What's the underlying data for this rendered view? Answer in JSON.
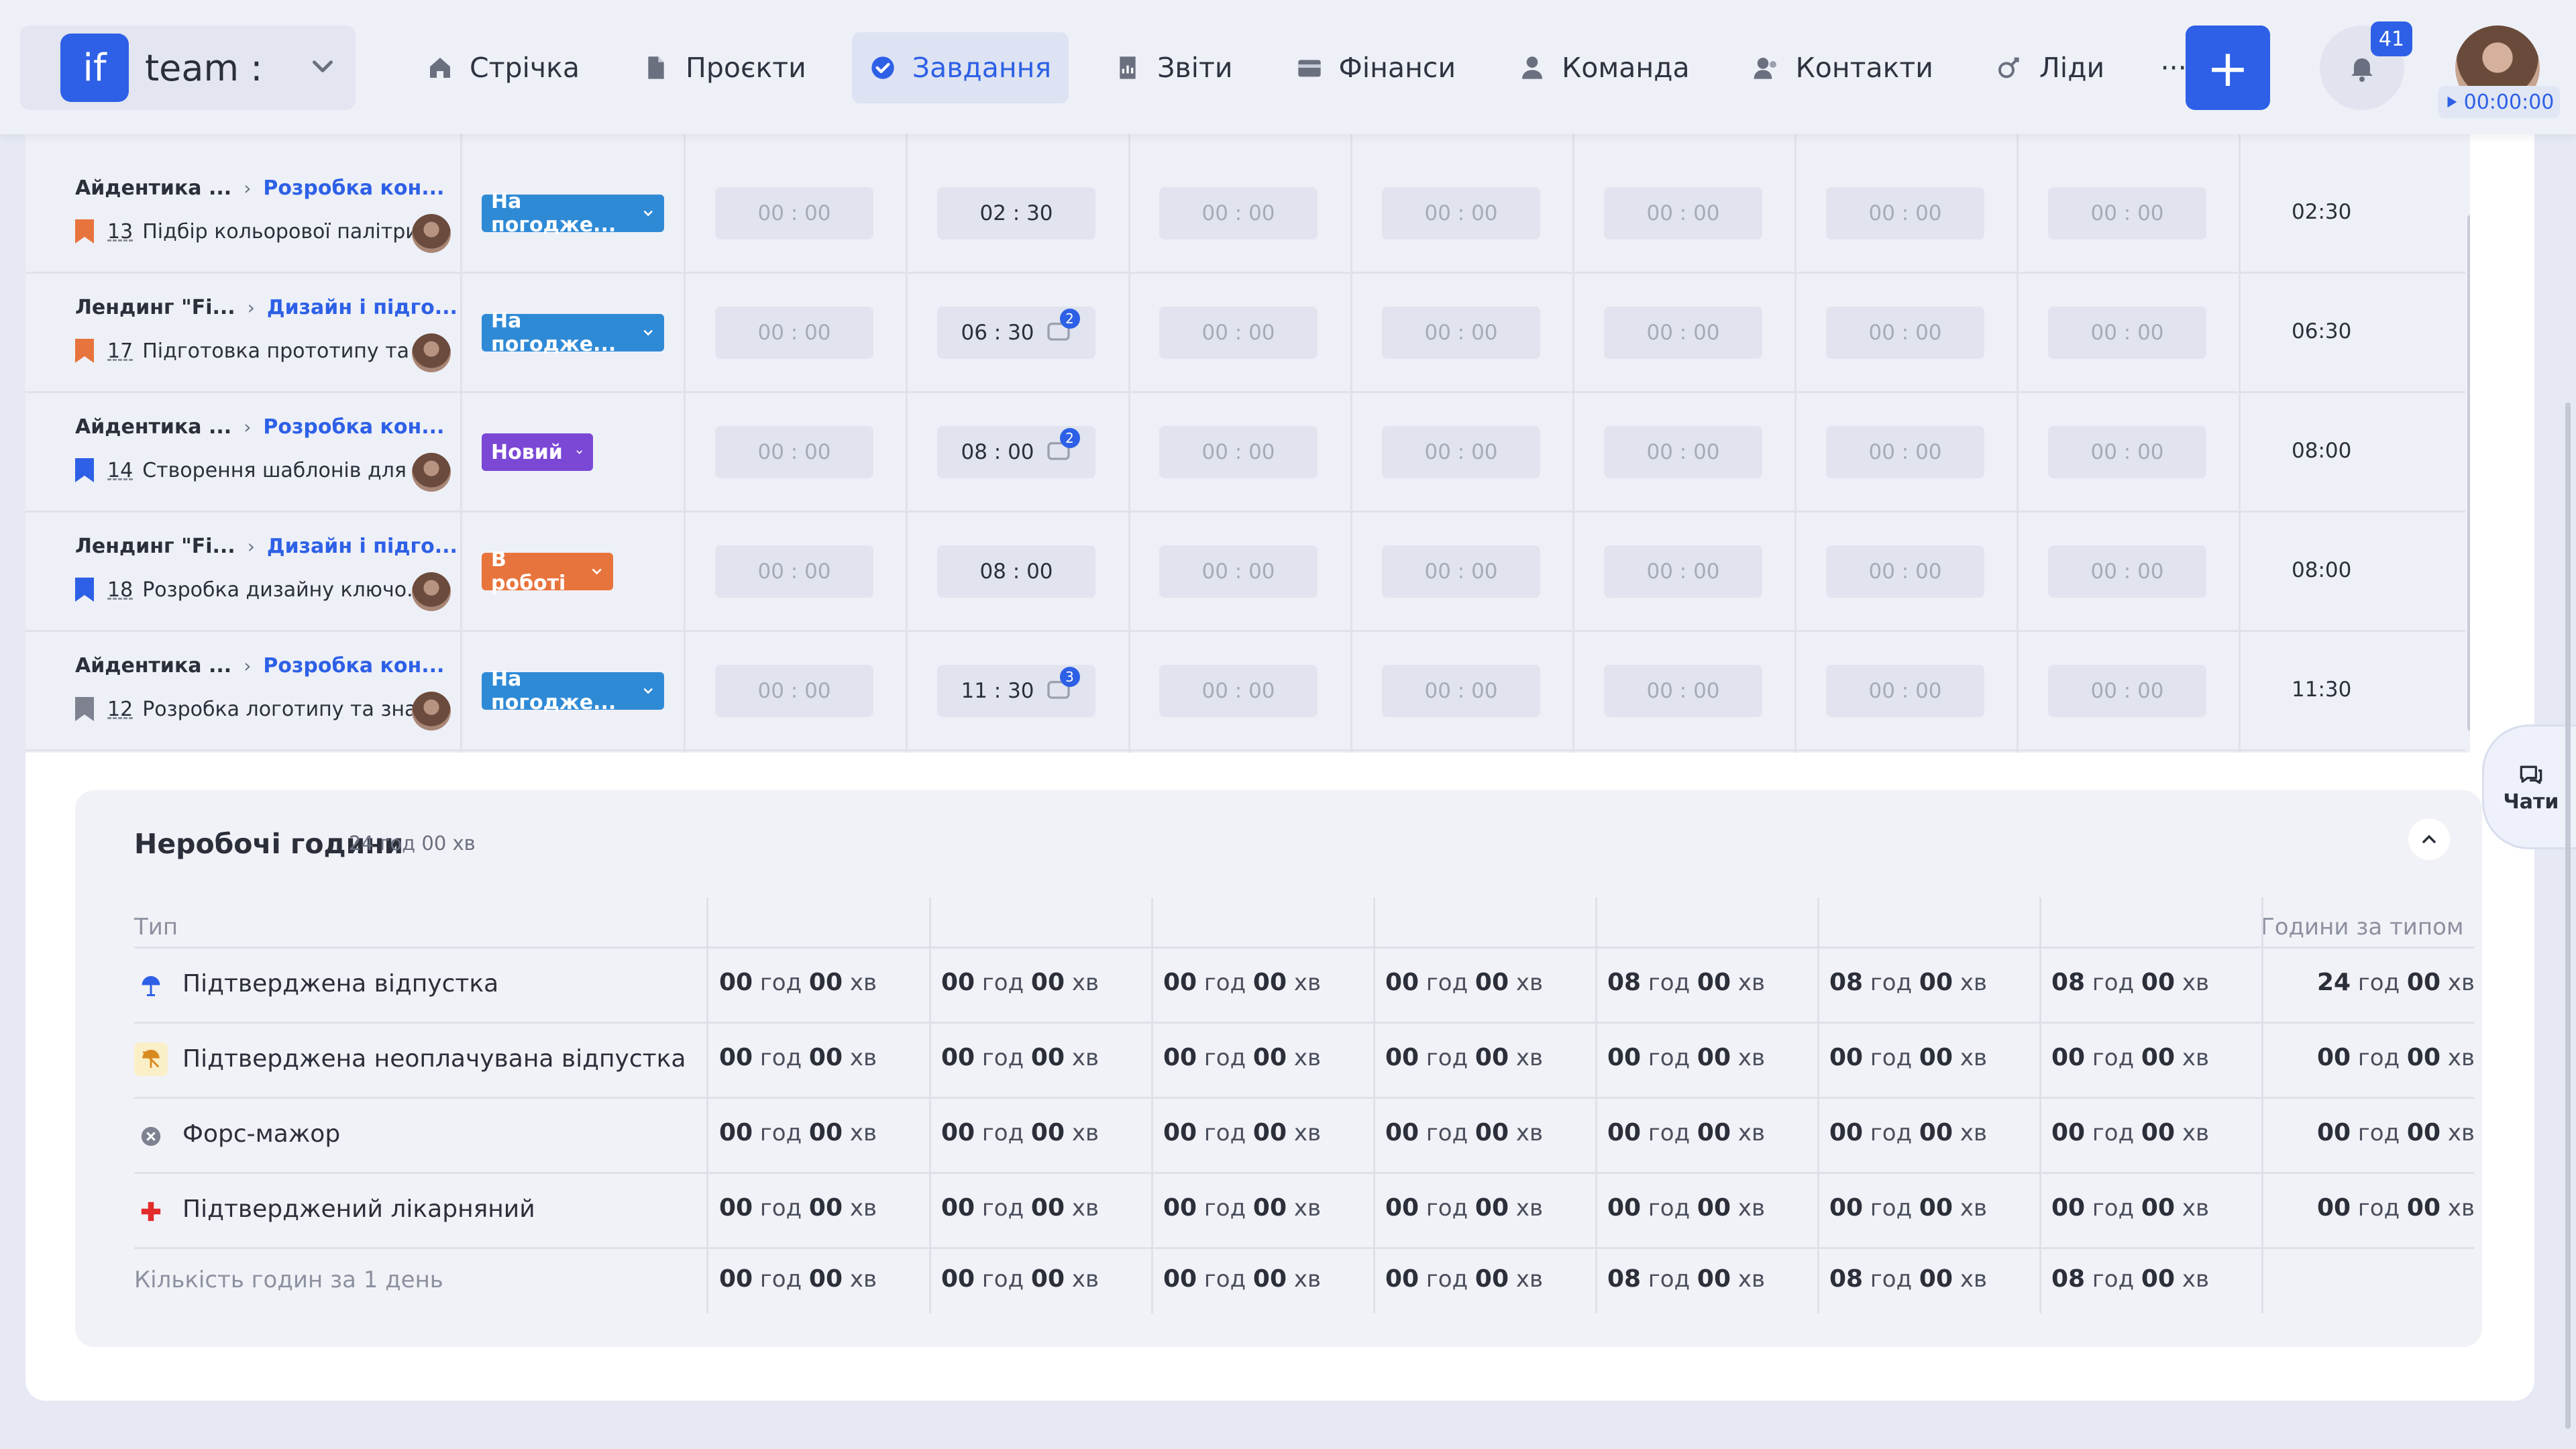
{
  "app": {
    "logo_text": "if",
    "team_name": "team :",
    "notifications_count": "41",
    "timer": "00:00:00",
    "add_label": "+"
  },
  "nav": [
    {
      "label": "Стрічка",
      "icon": "home-icon",
      "active": false
    },
    {
      "label": "Проєкти",
      "icon": "document-icon",
      "active": false
    },
    {
      "label": "Завдання",
      "icon": "check-circle-icon",
      "active": true
    },
    {
      "label": "Звіти",
      "icon": "report-icon",
      "active": false
    },
    {
      "label": "Фінанси",
      "icon": "wallet-icon",
      "active": false
    },
    {
      "label": "Команда",
      "icon": "person-icon",
      "active": false
    },
    {
      "label": "Контакти",
      "icon": "contacts-icon",
      "active": false
    },
    {
      "label": "Ліди",
      "icon": "leads-icon",
      "active": false
    }
  ],
  "nav_more": "···",
  "tasks": [
    {
      "project": "Айдентика ...",
      "subproject": "Розробка кон...",
      "num": "13",
      "title": "Підбір кольорової палітри...",
      "flag_color": "#e8743d",
      "status": "На погодже...",
      "status_color": "#2f8ad6",
      "cells": [
        "00 : 00",
        "02 : 30",
        "00 : 00",
        "00 : 00",
        "00 : 00",
        "00 : 00",
        "00 : 00"
      ],
      "comments": null,
      "total": "02:30"
    },
    {
      "project": "Лендинг \"Fi...",
      "subproject": "Дизайн і підго...",
      "num": "17",
      "title": "Підготовка прототипу та ...",
      "flag_color": "#e8743d",
      "status": "На погодже...",
      "status_color": "#2f8ad6",
      "cells": [
        "00 : 00",
        "06 : 30",
        "00 : 00",
        "00 : 00",
        "00 : 00",
        "00 : 00",
        "00 : 00"
      ],
      "comments": "2",
      "total": "06:30"
    },
    {
      "project": "Айдентика ...",
      "subproject": "Розробка кон...",
      "num": "14",
      "title": "Створення шаблонів для ...",
      "flag_color": "#2d60e6",
      "status": "Новий",
      "status_color": "#7b48d6",
      "cells": [
        "00 : 00",
        "08 : 00",
        "00 : 00",
        "00 : 00",
        "00 : 00",
        "00 : 00",
        "00 : 00"
      ],
      "comments": "2",
      "total": "08:00"
    },
    {
      "project": "Лендинг \"Fi...",
      "subproject": "Дизайн і підго...",
      "num": "18",
      "title": "Розробка дизайну ключо...",
      "flag_color": "#2d60e6",
      "status": "В роботі",
      "status_color": "#e8743d",
      "cells": [
        "00 : 00",
        "08 : 00",
        "00 : 00",
        "00 : 00",
        "00 : 00",
        "00 : 00",
        "00 : 00"
      ],
      "comments": null,
      "total": "08:00"
    },
    {
      "project": "Айдентика ...",
      "subproject": "Розробка кон...",
      "num": "12",
      "title": "Розробка логотипу та зна...",
      "flag_color": "#7d8190",
      "status": "На погодже...",
      "status_color": "#2f8ad6",
      "cells": [
        "00 : 00",
        "11 : 30",
        "00 : 00",
        "00 : 00",
        "00 : 00",
        "00 : 00",
        "00 : 00"
      ],
      "comments": "3",
      "total": "11:30"
    }
  ],
  "nonwork": {
    "title": "Неробочі години",
    "total": "24 год 00 хв",
    "type_header": "Тип",
    "by_type_header": "Години за типом",
    "hours_unit": "год",
    "min_unit": "хв",
    "rows": [
      {
        "label": "Підтверджена відпустка",
        "icon": "beach-umbrella-icon",
        "hours": [
          "00",
          "00",
          "00",
          "00",
          "08",
          "08",
          "08"
        ],
        "mins": [
          "00",
          "00",
          "00",
          "00",
          "00",
          "00",
          "00"
        ],
        "total_h": "24",
        "total_m": "00"
      },
      {
        "label": "Підтверджена неоплачувана відпустка",
        "icon": "unpaid-vacation-icon",
        "hours": [
          "00",
          "00",
          "00",
          "00",
          "00",
          "00",
          "00"
        ],
        "mins": [
          "00",
          "00",
          "00",
          "00",
          "00",
          "00",
          "00"
        ],
        "total_h": "00",
        "total_m": "00"
      },
      {
        "label": "Форс-мажор",
        "icon": "force-majeure-icon",
        "hours": [
          "00",
          "00",
          "00",
          "00",
          "00",
          "00",
          "00"
        ],
        "mins": [
          "00",
          "00",
          "00",
          "00",
          "00",
          "00",
          "00"
        ],
        "total_h": "00",
        "total_m": "00"
      },
      {
        "label": "Підтверджений лікарняний",
        "icon": "medical-cross-icon",
        "hours": [
          "00",
          "00",
          "00",
          "00",
          "00",
          "00",
          "00"
        ],
        "mins": [
          "00",
          "00",
          "00",
          "00",
          "00",
          "00",
          "00"
        ],
        "total_h": "00",
        "total_m": "00"
      }
    ],
    "footer": {
      "label": "Кількість годин за 1 день",
      "hours": [
        "00",
        "00",
        "00",
        "00",
        "08",
        "08",
        "08"
      ],
      "mins": [
        "00",
        "00",
        "00",
        "00",
        "00",
        "00",
        "00"
      ]
    }
  },
  "chats_label": "Чати"
}
